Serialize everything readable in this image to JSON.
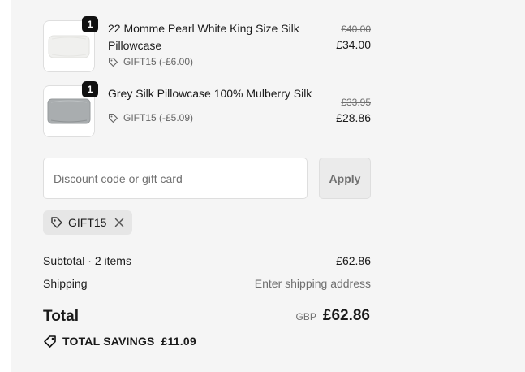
{
  "items": [
    {
      "name": "22 Momme Pearl White King Size Silk Pillowcase",
      "quantity": "1",
      "discount": "GIFT15 (-£6.00)",
      "original_price": "£40.00",
      "price": "£34.00",
      "thumbnail_color": "#f3f3f1"
    },
    {
      "name": "Grey Silk Pillowcase 100% Mulberry Silk",
      "quantity": "1",
      "discount": "GIFT15 (-£5.09)",
      "original_price": "£33.95",
      "price": "£28.86",
      "thumbnail_color": "#a9adaf"
    }
  ],
  "discount_form": {
    "placeholder": "Discount code or gift card",
    "apply_label": "Apply"
  },
  "applied_code": {
    "code": "GIFT15"
  },
  "summary": {
    "subtotal_label": "Subtotal · 2 items",
    "subtotal_value": "£62.86",
    "shipping_label": "Shipping",
    "shipping_value": "Enter shipping address",
    "total_label": "Total",
    "currency": "GBP",
    "total_value": "£62.86",
    "savings_label": "TOTAL SAVINGS",
    "savings_value": "£11.09"
  },
  "icons": {
    "tag": "tag-icon",
    "close": "close-icon",
    "savings": "savings-tag-icon"
  },
  "colors": {
    "panel_bg": "#f5f5f5",
    "text": "#1a1a1a",
    "muted": "#707070"
  }
}
